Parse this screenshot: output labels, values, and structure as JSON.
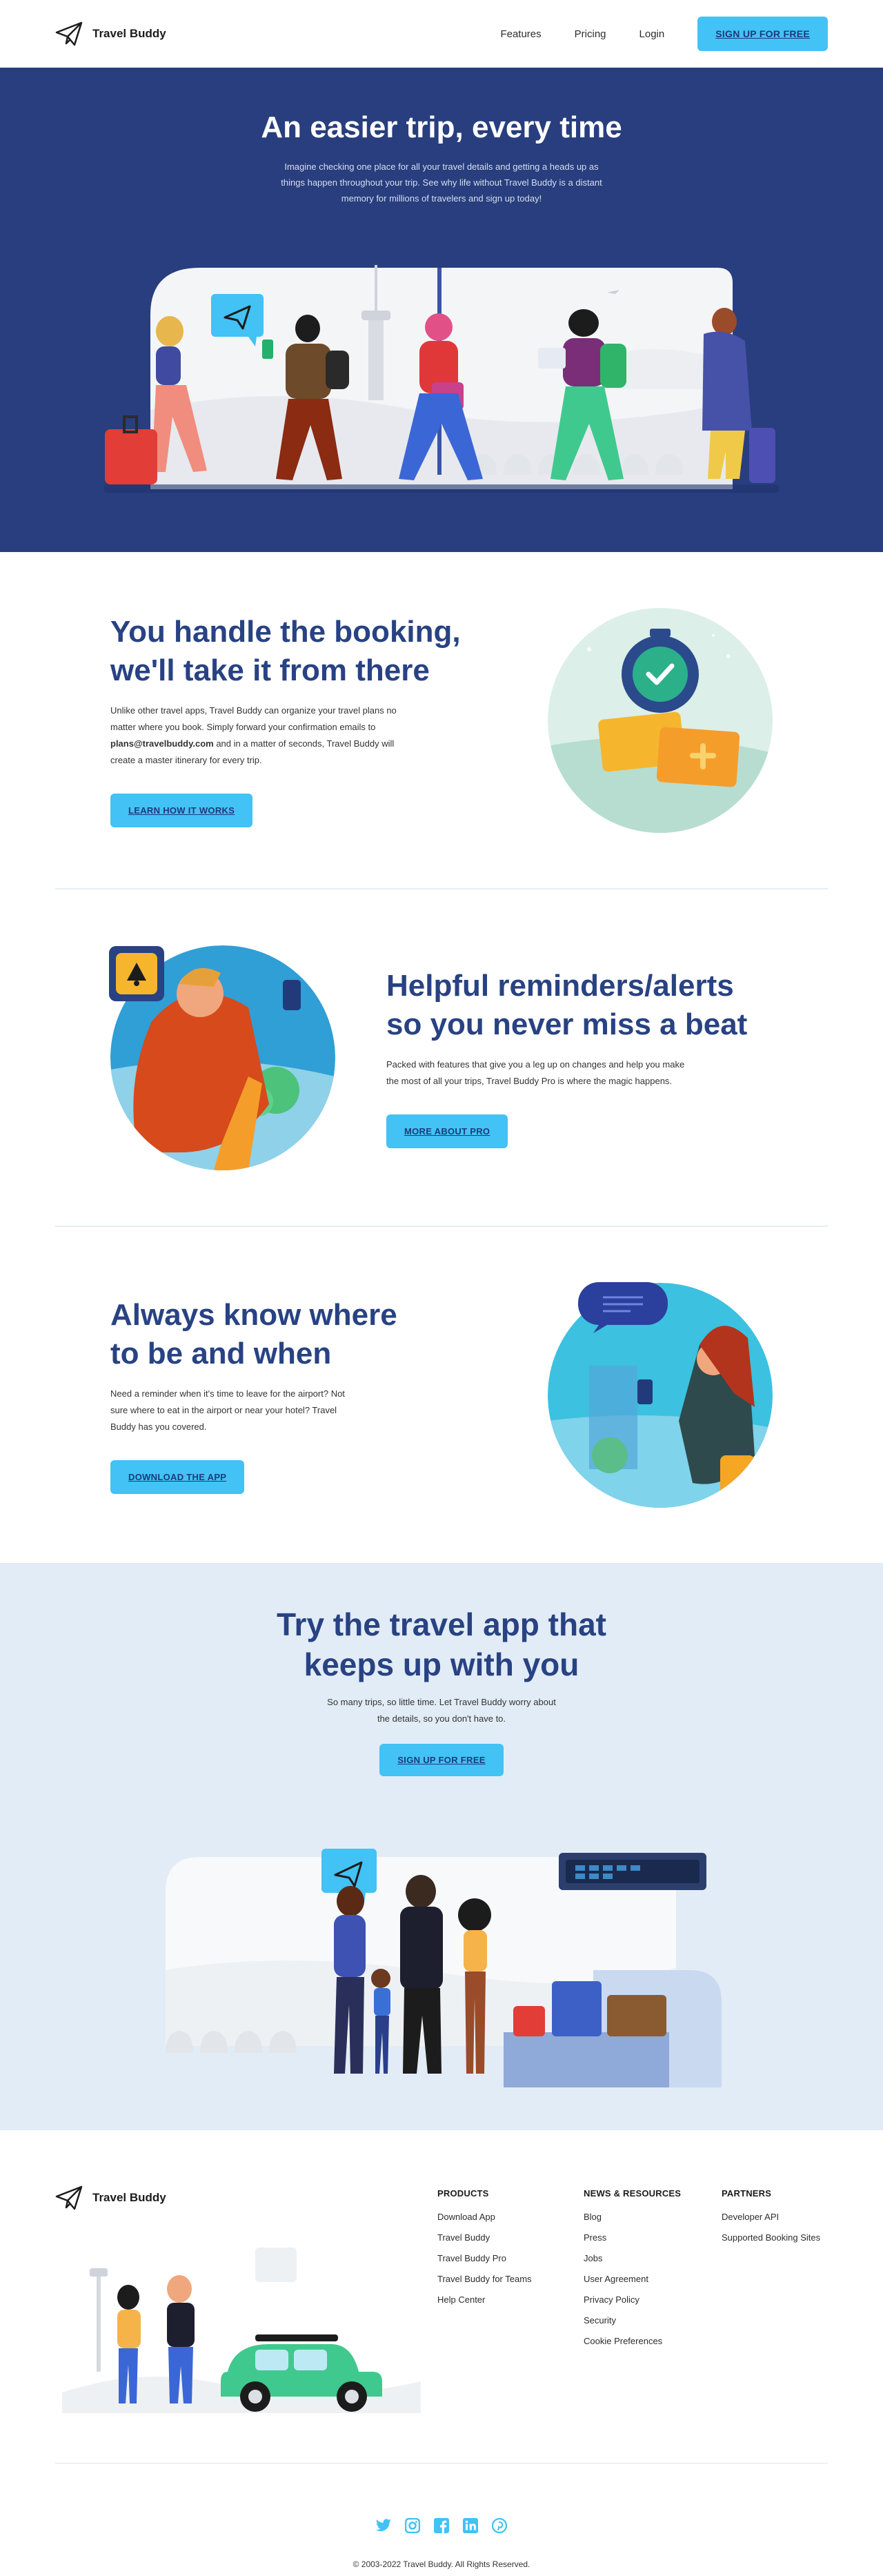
{
  "nav": {
    "brand": "Travel Buddy",
    "links": [
      "Features",
      "Pricing",
      "Login"
    ],
    "cta": "SIGN UP FOR FREE"
  },
  "hero": {
    "title": "An easier trip, every time",
    "text": "Imagine checking one place for all your travel details and getting a heads up as things happen throughout your trip. See why life without Travel Buddy is a distant memory for millions of travelers and sign up today!"
  },
  "features": [
    {
      "title_line1": "You handle the booking,",
      "title_line2": "we'll take it from there",
      "text_before": "Unlike other travel apps, Travel Buddy can organize your travel plans no matter where you book. Simply forward your confirmation emails to ",
      "text_bold": "plans@travelbuddy.com",
      "text_after": " and in a matter of seconds, Travel Buddy will create a master itinerary for every trip.",
      "button": "LEARN HOW IT WORKS"
    },
    {
      "title_line1": "Helpful reminders/alerts",
      "title_line2": "so you never miss a beat",
      "text": "Packed with features that give you a leg up on changes and help you make the most of all your trips, Travel Buddy Pro is where the magic happens.",
      "button": "MORE ABOUT PRO"
    },
    {
      "title_line1": "Always know where",
      "title_line2": "to be and when",
      "text": "Need a reminder when it's time to leave for the airport? Not sure where to eat in the airport or near your hotel? Travel Buddy has you covered.",
      "button": "DOWNLOAD THE APP"
    }
  ],
  "cta": {
    "title_line1": "Try the travel app that",
    "title_line2": "keeps up with you",
    "text": "So many trips, so little time. Let Travel Buddy worry about the details, so you don't have to.",
    "button": "SIGN UP FOR FREE"
  },
  "footer": {
    "brand": "Travel Buddy",
    "columns": [
      {
        "heading": "PRODUCTS",
        "links": [
          "Download App",
          "Travel Buddy",
          "Travel Buddy Pro",
          "Travel Buddy for Teams",
          "Help Center"
        ]
      },
      {
        "heading": "NEWS & RESOURCES",
        "links": [
          "Blog",
          "Press",
          "Jobs",
          "User Agreement",
          "Privacy Policy",
          "Security",
          "Cookie Preferences"
        ]
      },
      {
        "heading": "PARTNERS",
        "links": [
          "Developer API",
          "Supported Booking Sites"
        ]
      }
    ],
    "social": [
      "twitter-icon",
      "instagram-icon",
      "facebook-icon",
      "linkedin-icon",
      "pinterest-icon"
    ],
    "copyright": "© 2003-2022 Travel Buddy. All Rights Reserved."
  },
  "colors": {
    "brand_navy": "#283e7e",
    "accent_blue": "#42c2f5",
    "heading_blue": "#284283",
    "cta_bg": "#e2ecf6"
  }
}
